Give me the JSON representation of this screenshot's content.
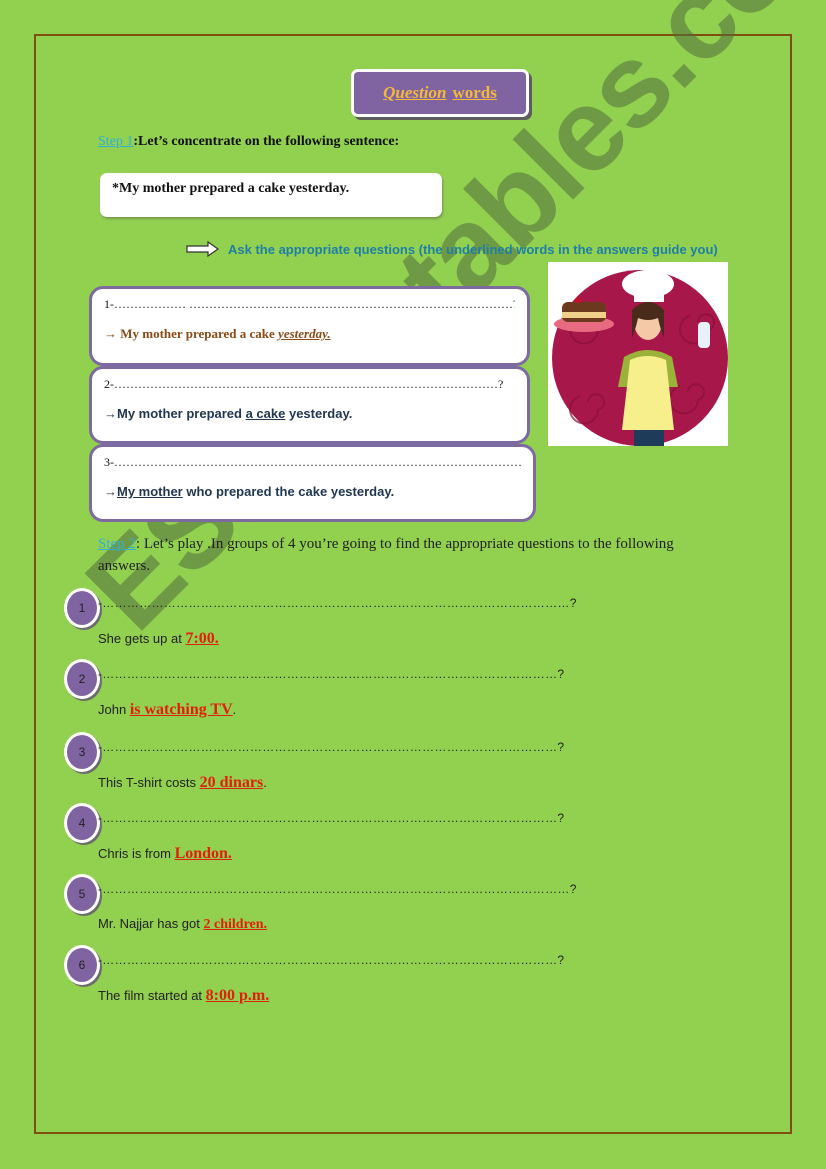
{
  "title": {
    "question": "Question",
    "words": "words"
  },
  "step1": {
    "label": "Step 1",
    "text": ":Let’s concentrate on the following sentence:"
  },
  "sentence": "*My mother prepared a cake yesterday.",
  "instruction": "Ask the appropriate questions (the underlined words in the answers guide you)",
  "questions": [
    {
      "line": "1-……………… ………………………………………………………………………?",
      "answer_prefix": "→ My mother prepared a cake ",
      "answer_underlined": "yesterday.",
      "answer_suffix": ""
    },
    {
      "line": "2-……………………………………………………………………………………?",
      "answer_prefix": "→My mother prepared ",
      "answer_underlined": "a cake",
      "answer_suffix": " yesterday."
    },
    {
      "line": "3-………………………………………………………………………………………………?",
      "answer_prefix": "→",
      "answer_underlined": "My mother",
      "answer_suffix": " who  prepared the cake yesterday."
    }
  ],
  "step2": {
    "label": "Step 2",
    "text": ": Let’s play .In groups of 4 you’re going to find the appropriate questions to the following answers."
  },
  "items": [
    {
      "num": "1",
      "line": "-……………………………………………………………………………………………………?",
      "prefix": "She  gets up at ",
      "highlight": "7:00.",
      "suffix": ""
    },
    {
      "num": "2",
      "line": "-…………………………………………………………………………………………………?",
      "prefix": "John  ",
      "highlight": "is watching  TV",
      "suffix": "."
    },
    {
      "num": "3",
      "line": "-…………………………………………………………………………………………………?",
      "prefix": "This T-shirt costs  ",
      "highlight": "20 dinars",
      "suffix": "."
    },
    {
      "num": "4",
      "line": "-…………………………………………………………………………………………………?",
      "prefix": "Chris is from ",
      "highlight": "London.",
      "suffix": ""
    },
    {
      "num": "5",
      "line": "-……………………………………………………………………………………………………?",
      "prefix": "Mr. Najjar has got ",
      "highlight": "2 children.",
      "suffix": ""
    },
    {
      "num": "6",
      "line": "-…………………………………………………………………………………………………?",
      "prefix": "The film started at ",
      "highlight": "8:00 p.m.",
      "suffix": ""
    }
  ],
  "image": {
    "alt": "chef woman holding a cake"
  },
  "watermark": "ESLprintables.com",
  "colors": {
    "background": "#92d050",
    "frame": "#7f4f10",
    "title_bg": "#8064a2",
    "title_text": "#f4b93a",
    "step_label": "#31b0d5",
    "instruction": "#1f7fa4",
    "highlight": "#e0200c"
  }
}
